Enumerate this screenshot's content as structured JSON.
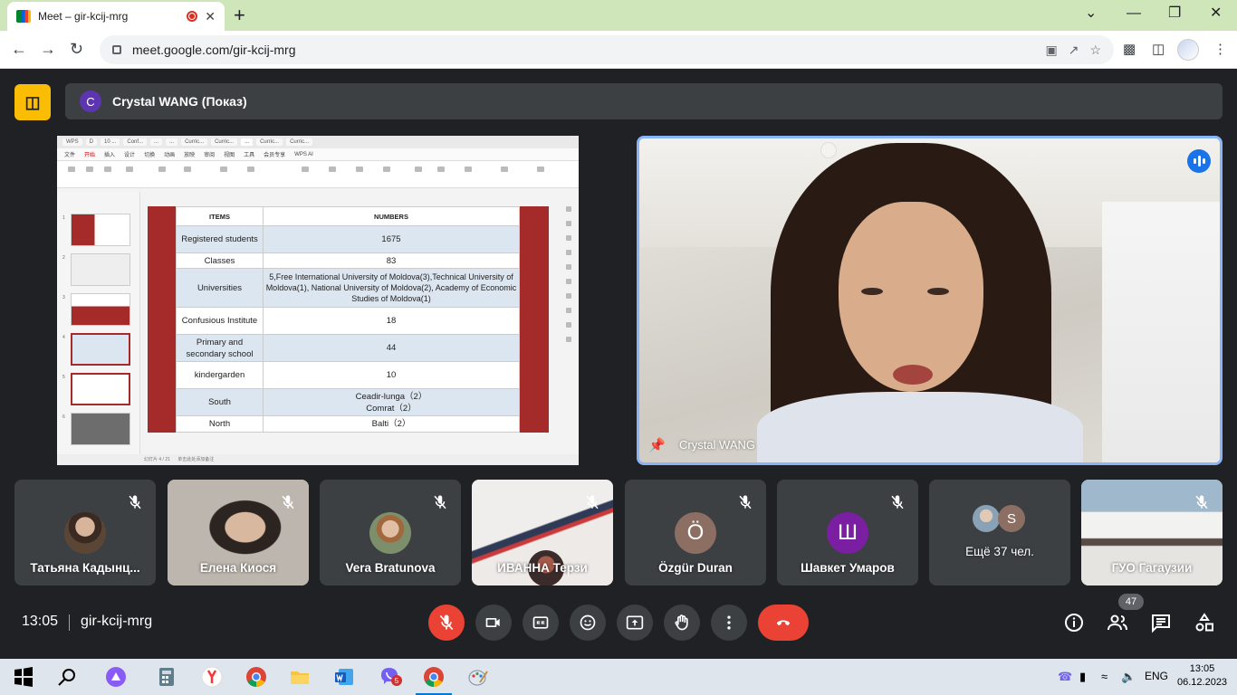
{
  "browser": {
    "tab_title": "Meet – gir-kcij-mrg",
    "close_glyph": "✕",
    "new_tab_glyph": "+",
    "url": "meet.google.com/gir-kcij-mrg",
    "window_controls": {
      "minimize": "—",
      "restore": "❐",
      "close": "✕",
      "tab_search": "⌄"
    }
  },
  "presentation": {
    "presenter_initial": "C",
    "presenter_label": "Crystal WANG (Показ)"
  },
  "shared_screen": {
    "wps_tabs": [
      "WPS",
      "D",
      "10 ...",
      "Conf...",
      "...",
      "...",
      "Curric...",
      "Curric...",
      "...",
      "Curric...",
      "Curric..."
    ],
    "wps_menu": [
      "文件",
      "开始",
      "插入",
      "设计",
      "切换",
      "动画",
      "放映",
      "审阅",
      "视图",
      "工具",
      "会员专享",
      "WPS AI"
    ],
    "status_left": "幻灯片 4 / 21",
    "status_center": "单击此处添加备注",
    "thumb_numbers": [
      "1",
      "2",
      "3",
      "4",
      "5",
      "6"
    ],
    "table": {
      "headers": [
        "ITEMS",
        "NUMBERS"
      ],
      "rows": [
        {
          "item": "Registered students",
          "value": "1675"
        },
        {
          "item": "Classes",
          "value": "83"
        },
        {
          "item": "Universities",
          "value": "5,Free International University of Moldova(3),Technical University of Moldova(1),  National University of Moldova(2), Academy of Economic Studies of Moldova(1)"
        },
        {
          "item": "Confusious Institute",
          "value": "18"
        },
        {
          "item": "Primary and secondary school",
          "value": "44"
        },
        {
          "item": "kindergarden",
          "value": "10"
        },
        {
          "item": "South",
          "value": "Ceadir-lunga（2）\nComrat（2）"
        },
        {
          "item": "North",
          "value": "Balti（2）"
        }
      ]
    }
  },
  "speaker": {
    "name": "Crystal WANG"
  },
  "participants": [
    {
      "name": "Татьяна Кадынц...",
      "kind": "photo",
      "color": "#5b4636"
    },
    {
      "name": "Елена Киося",
      "kind": "video",
      "color": "#b7b1aa"
    },
    {
      "name": "Vera Bratunova",
      "kind": "photo",
      "color": "#7c8f6a"
    },
    {
      "name": "ИВАННА Терзи",
      "kind": "video",
      "color": "#d9d4d0"
    },
    {
      "name": "Özgür Duran",
      "kind": "letter",
      "letter": "Ö",
      "color": "#8d6e63"
    },
    {
      "name": "Шавкет Умаров",
      "kind": "letter",
      "letter": "Ш",
      "color": "#7b1fa2"
    },
    {
      "name": "Ещё 37 чел.",
      "kind": "more",
      "letter": "S",
      "color": "#8d6e63"
    },
    {
      "name": "ГУО Гагаузии",
      "kind": "video",
      "color": "#cfd6dc"
    }
  ],
  "callbar": {
    "time": "13:05",
    "meeting_code": "gir-kcij-mrg",
    "participant_count": "47",
    "colors": {
      "danger": "#ea4335",
      "control": "#3c4043"
    }
  },
  "taskbar": {
    "language": "ENG",
    "time": "13:05",
    "date": "06.12.2023",
    "viber_badge": "5"
  }
}
